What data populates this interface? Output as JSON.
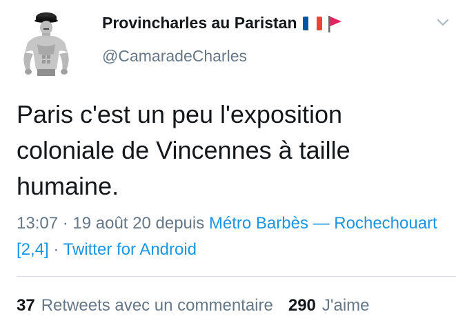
{
  "author": {
    "display_name": "Provincharles au Paristan",
    "handle": "@CamaradeCharles",
    "avatar": "grayscale-muscular-figure-with-cap",
    "badges": [
      "flag-france-icon",
      "red-flag-icon"
    ]
  },
  "tweet": {
    "text": "Paris c'est un peu l'exposition coloniale de Vincennes à taille humaine.",
    "time": "13:07",
    "separator1": " · ",
    "date": "19 août 20",
    "depuis": " depuis ",
    "location": "Métro Barbès — Rochechouart [2,4]",
    "separator2": " · ",
    "client": "Twitter for Android"
  },
  "stats": {
    "retweets_count": "37",
    "retweets_label": "Retweets avec un commentaire",
    "likes_count": "290",
    "likes_label": "J'aime"
  },
  "menu": {
    "icon": "chevron-down-icon"
  },
  "colors": {
    "text": "#14171a",
    "secondary": "#657786",
    "link": "#1b95e0",
    "divider": "#d5dbe0",
    "flag_blue": "#0055a4",
    "flag_red": "#ef4135",
    "red_flag": "#e0245e"
  }
}
